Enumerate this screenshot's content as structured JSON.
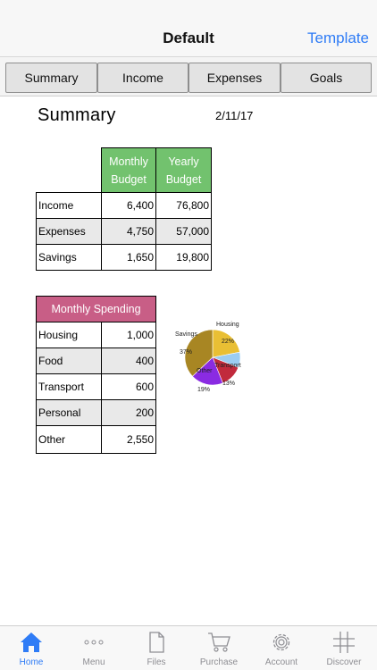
{
  "nav": {
    "title": "Default",
    "right_button": "Template"
  },
  "tabs": [
    "Summary",
    "Income",
    "Expenses",
    "Goals"
  ],
  "sheet": {
    "title": "Summary",
    "date": "2/11/17",
    "budget_table": {
      "headers": [
        "Monthly Budget",
        "Yearly Budget"
      ],
      "rows": [
        {
          "label": "Income",
          "monthly": "6,400",
          "yearly": "76,800"
        },
        {
          "label": "Expenses",
          "monthly": "4,750",
          "yearly": "57,000"
        },
        {
          "label": "Savings",
          "monthly": "1,650",
          "yearly": "19,800"
        }
      ]
    },
    "spending_table": {
      "header": "Monthly Spending",
      "rows": [
        {
          "label": "Housing",
          "value": "1,000"
        },
        {
          "label": "Food",
          "value": "400"
        },
        {
          "label": "Transport",
          "value": "600"
        },
        {
          "label": "Personal",
          "value": "200"
        },
        {
          "label": "Other",
          "value": "2,550"
        }
      ]
    }
  },
  "chart_data": {
    "type": "pie",
    "slices": [
      {
        "label": "Housing",
        "percent": "22%",
        "value": 22,
        "color": "#e9bf34"
      },
      {
        "label": "",
        "percent": "",
        "value": 9,
        "color": "#9ccdf2"
      },
      {
        "label": "Transport",
        "percent": "13%",
        "value": 13,
        "color": "#c12a3c"
      },
      {
        "label": "Other",
        "percent": "19%",
        "value": 19,
        "color": "#8a2be2"
      },
      {
        "label": "Savings",
        "percent": "37%",
        "value": 37,
        "color": "#a88623"
      }
    ]
  },
  "bottom_tabs": [
    {
      "label": "Home",
      "icon": "home-icon",
      "active": true
    },
    {
      "label": "Menu",
      "icon": "more-dots-icon",
      "active": false
    },
    {
      "label": "Files",
      "icon": "file-icon",
      "active": false
    },
    {
      "label": "Purchase",
      "icon": "cart-icon",
      "active": false
    },
    {
      "label": "Account",
      "icon": "gear-icon",
      "active": false
    },
    {
      "label": "Discover",
      "icon": "hash-icon",
      "active": false
    }
  ],
  "colors": {
    "accent": "#2f7cf6",
    "header_green": "#72c26e",
    "header_pink": "#c85e86"
  }
}
